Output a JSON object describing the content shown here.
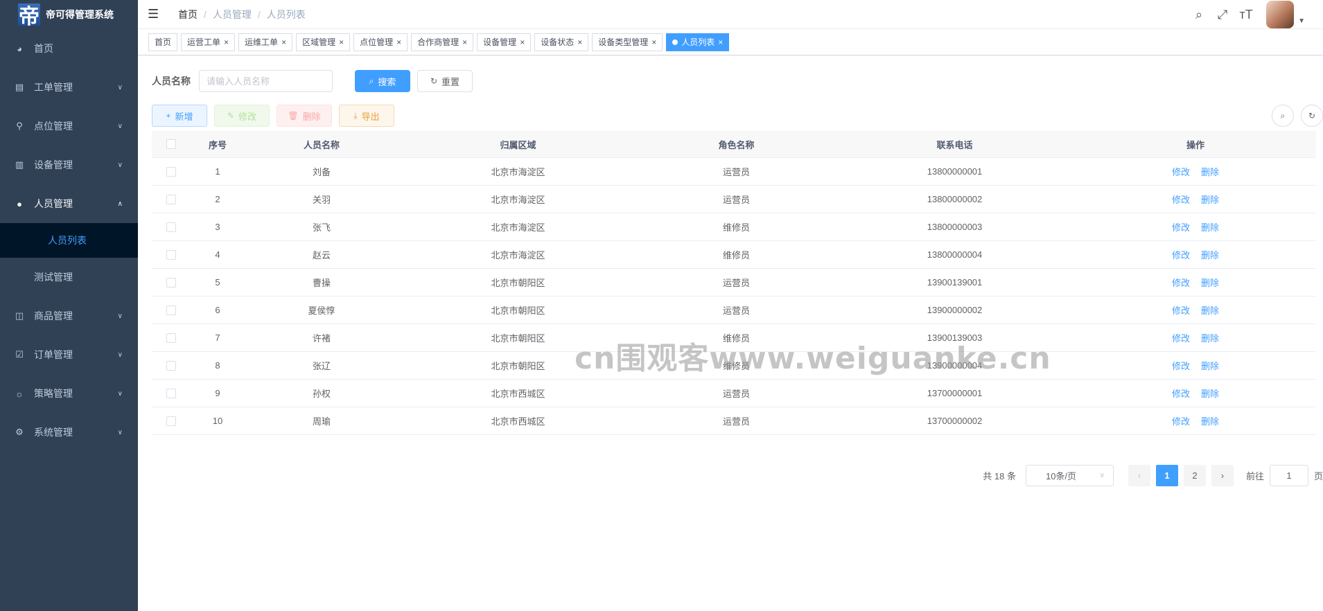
{
  "app": {
    "title": "帝可得管理系统",
    "logo_char": "帝"
  },
  "sidebar": {
    "items": [
      {
        "label": "首页"
      },
      {
        "label": "工单管理"
      },
      {
        "label": "点位管理"
      },
      {
        "label": "设备管理"
      },
      {
        "label": "人员管理"
      },
      {
        "label": "人员列表"
      },
      {
        "label": "测试管理"
      },
      {
        "label": "商品管理"
      },
      {
        "label": "订单管理"
      },
      {
        "label": "策略管理"
      },
      {
        "label": "系统管理"
      }
    ]
  },
  "breadcrumb": [
    "首页",
    "人员管理",
    "人员列表"
  ],
  "tags": [
    "首页",
    "运营工单",
    "运维工单",
    "区域管理",
    "点位管理",
    "合作商管理",
    "设备管理",
    "设备状态",
    "设备类型管理",
    "人员列表"
  ],
  "search": {
    "label": "人员名称",
    "placeholder": "请输入人员名称",
    "search_btn": "搜索",
    "reset_btn": "重置"
  },
  "toolbar": {
    "add": "新增",
    "edit": "修改",
    "delete": "删除",
    "export": "导出"
  },
  "table": {
    "headers": [
      "序号",
      "人员名称",
      "归属区域",
      "角色名称",
      "联系电话",
      "操作"
    ],
    "rows": [
      {
        "idx": "1",
        "name": "刘备",
        "region": "北京市海淀区",
        "role": "运营员",
        "phone": "13800000001"
      },
      {
        "idx": "2",
        "name": "关羽",
        "region": "北京市海淀区",
        "role": "运营员",
        "phone": "13800000002"
      },
      {
        "idx": "3",
        "name": "张飞",
        "region": "北京市海淀区",
        "role": "维修员",
        "phone": "13800000003"
      },
      {
        "idx": "4",
        "name": "赵云",
        "region": "北京市海淀区",
        "role": "维修员",
        "phone": "13800000004"
      },
      {
        "idx": "5",
        "name": "曹操",
        "region": "北京市朝阳区",
        "role": "运营员",
        "phone": "13900139001"
      },
      {
        "idx": "6",
        "name": "夏侯惇",
        "region": "北京市朝阳区",
        "role": "运营员",
        "phone": "13900000002"
      },
      {
        "idx": "7",
        "name": "许褚",
        "region": "北京市朝阳区",
        "role": "维修员",
        "phone": "13900139003"
      },
      {
        "idx": "8",
        "name": "张辽",
        "region": "北京市朝阳区",
        "role": "维修员",
        "phone": "13900000004"
      },
      {
        "idx": "9",
        "name": "孙权",
        "region": "北京市西城区",
        "role": "运营员",
        "phone": "13700000001"
      },
      {
        "idx": "10",
        "name": "周瑜",
        "region": "北京市西城区",
        "role": "运营员",
        "phone": "13700000002"
      }
    ],
    "op_edit": "修改",
    "op_delete": "删除"
  },
  "pagination": {
    "total_text": "共 18 条",
    "page_size": "10条/页",
    "pages": [
      "1",
      "2"
    ],
    "current": "1",
    "goto_label": "前往",
    "goto_value": "1",
    "page_suffix": "页"
  },
  "watermark": "cn围观客www.weiguanke.cn",
  "colors": {
    "sidebar_bg": "#304156",
    "primary": "#409eff",
    "active_sub_bg": "#001528"
  }
}
